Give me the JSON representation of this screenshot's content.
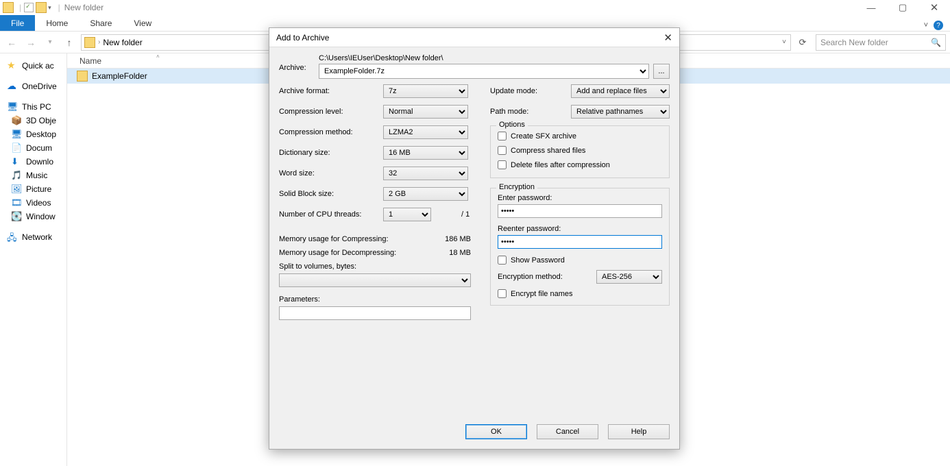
{
  "window": {
    "title": "New folder",
    "controls": {
      "minimize": "—",
      "maximize": "▢",
      "close": "✕"
    }
  },
  "ribbon": {
    "file": "File",
    "tabs": [
      "Home",
      "Share",
      "View"
    ],
    "help": "?"
  },
  "nav": {
    "back": "←",
    "fwd": "→",
    "recent": "▾",
    "up": "↑",
    "crumb": "New folder",
    "search_placeholder": "Search New folder",
    "refresh": "⟳"
  },
  "tree": {
    "quick": "Quick ac",
    "onedrive": "OneDrive",
    "thispc": "This PC",
    "items": [
      "3D Obje",
      "Desktop",
      "Docum",
      "Downlo",
      "Music",
      "Picture",
      "Videos",
      "Window"
    ],
    "network": "Network"
  },
  "list": {
    "col_name": "Name",
    "rows": [
      "ExampleFolder"
    ]
  },
  "dialog": {
    "title": "Add to Archive",
    "close": "✕",
    "archive_lbl": "Archive:",
    "archive_path": "C:\\Users\\IEUser\\Desktop\\New folder\\",
    "archive_name": "ExampleFolder.7z",
    "browse": "...",
    "left": {
      "format_lbl": "Archive format:",
      "format_val": "7z",
      "level_lbl": "Compression level:",
      "level_val": "Normal",
      "method_lbl": "Compression method:",
      "method_val": "LZMA2",
      "dict_lbl": "Dictionary size:",
      "dict_val": "16 MB",
      "word_lbl": "Word size:",
      "word_val": "32",
      "block_lbl": "Solid Block size:",
      "block_val": "2 GB",
      "threads_lbl": "Number of CPU threads:",
      "threads_val": "1",
      "threads_max": "/ 1",
      "mem_comp_lbl": "Memory usage for Compressing:",
      "mem_comp_val": "186 MB",
      "mem_decomp_lbl": "Memory usage for Decompressing:",
      "mem_decomp_val": "18 MB",
      "split_lbl": "Split to volumes, bytes:",
      "param_lbl": "Parameters:"
    },
    "right": {
      "update_lbl": "Update mode:",
      "update_val": "Add and replace files",
      "path_lbl": "Path mode:",
      "path_val": "Relative pathnames",
      "options_legend": "Options",
      "opt_sfx": "Create SFX archive",
      "opt_shared": "Compress shared files",
      "opt_delete": "Delete files after compression",
      "enc_legend": "Encryption",
      "enter_pw": "Enter password:",
      "reenter_pw": "Reenter password:",
      "pw_value": "•••••",
      "show_pw": "Show Password",
      "enc_method_lbl": "Encryption method:",
      "enc_method_val": "AES-256",
      "enc_names": "Encrypt file names"
    },
    "buttons": {
      "ok": "OK",
      "cancel": "Cancel",
      "help": "Help"
    }
  }
}
